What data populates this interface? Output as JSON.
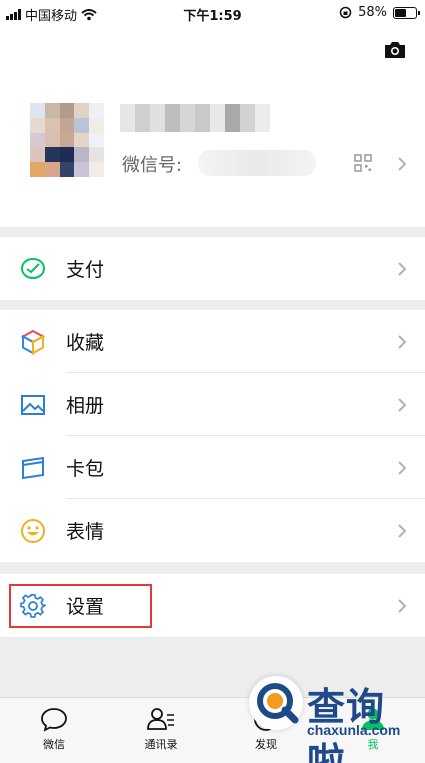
{
  "status_bar": {
    "carrier": "中国移动",
    "time": "下午1:59",
    "battery_percent": "58%",
    "battery_level": 0.58
  },
  "profile": {
    "wechat_id_label": "微信号:"
  },
  "menu": {
    "pay": "支付",
    "favorites": "收藏",
    "album": "相册",
    "cards": "卡包",
    "stickers": "表情",
    "settings": "设置"
  },
  "tabs": [
    {
      "label": "微信",
      "icon": "chat-bubble-icon"
    },
    {
      "label": "通讯录",
      "icon": "contacts-icon"
    },
    {
      "label": "发现",
      "icon": "compass-icon"
    },
    {
      "label": "我",
      "icon": "me-icon",
      "active": true
    }
  ],
  "watermark": {
    "title": "查询啦",
    "url": "chaxunla.com"
  },
  "colors": {
    "accent_green": "#07c160",
    "highlight_red": "#e03a3a",
    "watermark_blue": "#1f4a8a",
    "watermark_orange": "#f29b1d"
  }
}
